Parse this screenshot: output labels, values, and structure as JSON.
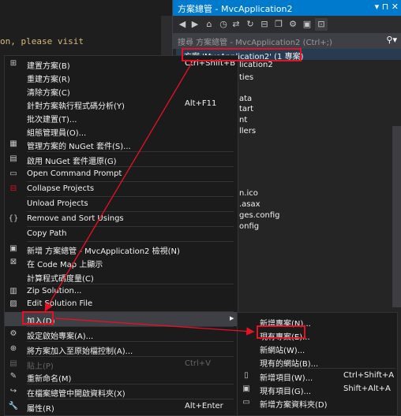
{
  "editor": {
    "code_line": "on, please visit"
  },
  "solution_explorer": {
    "title": "方案總管 - MvcApplication2",
    "title_buttons": "▾ ⊓ ✕",
    "search_placeholder": "搜尋 方案總管 - MvcApplication2 (Ctrl+;)",
    "tree_items": [
      "方案 'MvcApplication2' (1 專案)",
      "lication2",
      "ties",
      "ata",
      "tart",
      "nt",
      "llers",
      "n.ico",
      ".asax",
      "ges.config",
      "onfig"
    ]
  },
  "context_menu": {
    "items": [
      {
        "label": "建置方案(B)",
        "shortcut": "Ctrl+Shift+B",
        "icon": "build-icon"
      },
      {
        "label": "重建方案(R)",
        "shortcut": "",
        "icon": ""
      },
      {
        "label": "清除方案(C)",
        "shortcut": "",
        "icon": ""
      },
      {
        "label": "針對方案執行程式碼分析(Y)",
        "shortcut": "Alt+F11",
        "icon": ""
      },
      {
        "label": "批次建置(T)...",
        "shortcut": "",
        "icon": ""
      },
      {
        "label": "組態管理員(O)...",
        "shortcut": "",
        "icon": ""
      },
      {
        "label": "管理方案的 NuGet 套件(S)...",
        "shortcut": "",
        "icon": "nuget-icon"
      },
      {
        "label": "啟用 NuGet 套件還原(G)",
        "shortcut": "",
        "icon": "package-restore-icon"
      },
      {
        "label": "Open Command Prompt",
        "shortcut": "",
        "icon": "command-prompt-icon"
      },
      {
        "label": "Collapse Projects",
        "shortcut": "",
        "icon": "collapse-icon"
      },
      {
        "label": "Unload Projects",
        "shortcut": "",
        "icon": ""
      },
      {
        "label": "Remove and Sort Usings",
        "shortcut": "",
        "icon": "usings-icon"
      },
      {
        "label": "Copy Path",
        "shortcut": "",
        "icon": ""
      },
      {
        "label": "新增 方案總管 - MvcApplication2 檢視(N)",
        "shortcut": "",
        "icon": "new-view-icon"
      },
      {
        "label": "在 Code Map 上顯示",
        "shortcut": "",
        "icon": "code-map-icon"
      },
      {
        "label": "計算程式碼度量(C)",
        "shortcut": "",
        "icon": ""
      },
      {
        "label": "Zip Solution...",
        "shortcut": "",
        "icon": "zip-icon"
      },
      {
        "label": "Edit Solution File",
        "shortcut": "",
        "icon": "edit-file-icon"
      },
      {
        "label": "加入(D)",
        "shortcut": "",
        "icon": ""
      },
      {
        "label": "設定啟始專案(A)...",
        "shortcut": "",
        "icon": "gear-icon"
      },
      {
        "label": "將方案加入至原始檔控制(A)...",
        "shortcut": "",
        "icon": "source-control-icon"
      },
      {
        "label": "貼上(P)",
        "shortcut": "Ctrl+V",
        "icon": "paste-icon"
      },
      {
        "label": "重新命名(M)",
        "shortcut": "",
        "icon": "rename-icon"
      },
      {
        "label": "在檔案總管中開啟資料夾(X)",
        "shortcut": "",
        "icon": "open-folder-icon"
      },
      {
        "label": "屬性(R)",
        "shortcut": "Alt+Enter",
        "icon": "wrench-icon"
      }
    ]
  },
  "submenu": {
    "items": [
      {
        "label": "新增專案(N)...",
        "shortcut": ""
      },
      {
        "label": "現有專案(E)...",
        "shortcut": ""
      },
      {
        "label": "新網站(W)...",
        "shortcut": ""
      },
      {
        "label": "現有的網站(B)...",
        "shortcut": ""
      },
      {
        "label": "新增項目(W)...",
        "shortcut": "Ctrl+Shift+A"
      },
      {
        "label": "現有項目(G)...",
        "shortcut": "Shift+Alt+A"
      },
      {
        "label": "新增方案資料夾(D)",
        "shortcut": ""
      }
    ]
  },
  "colors": {
    "accent": "#007acc",
    "annotation": "#e81123",
    "menu_bg": "#1b1b1c"
  }
}
